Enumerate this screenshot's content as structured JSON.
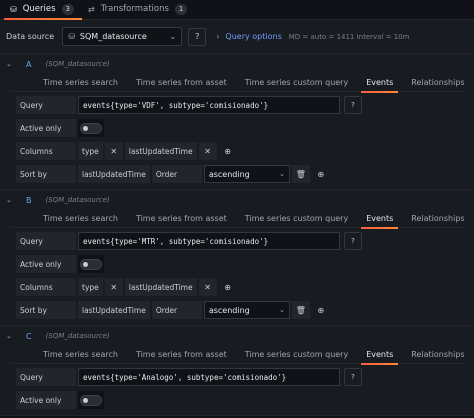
{
  "top_tabs": [
    {
      "label": "Queries",
      "count": "3",
      "icon": "database-icon",
      "active": true
    },
    {
      "label": "Transformations",
      "count": "1",
      "icon": "transform-icon",
      "active": false
    }
  ],
  "datasource": {
    "label": "Data source",
    "selected": "SQM_datasource",
    "query_options_label": "Query options",
    "meta": "MD = auto = 1411   Interval = 10m"
  },
  "query_tabs": [
    "Time series search",
    "Time series from asset",
    "Time series custom query",
    "Events",
    "Relationships"
  ],
  "labels": {
    "query": "Query",
    "active_only": "Active only",
    "columns": "Columns",
    "sort_by": "Sort by",
    "order": "Order"
  },
  "queries": [
    {
      "letter": "A",
      "datasource": "(SQM_datasource)",
      "query": "events{type='VDF', subtype='comisionado'}",
      "columns": [
        "type",
        "lastUpdatedTime"
      ],
      "sort_by": "lastUpdatedTime",
      "order": "ascending"
    },
    {
      "letter": "B",
      "datasource": "(SQM_datasource)",
      "query": "events{type='MTR', subtype='comisionado'}",
      "columns": [
        "type",
        "lastUpdatedTime"
      ],
      "sort_by": "lastUpdatedTime",
      "order": "ascending"
    },
    {
      "letter": "C",
      "datasource": "(SQM_datasource)",
      "query": "events{type='Analogo', subtype='comisionado'}",
      "columns": [],
      "sort_by": "",
      "order": ""
    }
  ],
  "colors": {
    "accent": "#ff8833",
    "link": "#6e9fff",
    "background": "#111217",
    "panel": "#181b1f"
  }
}
